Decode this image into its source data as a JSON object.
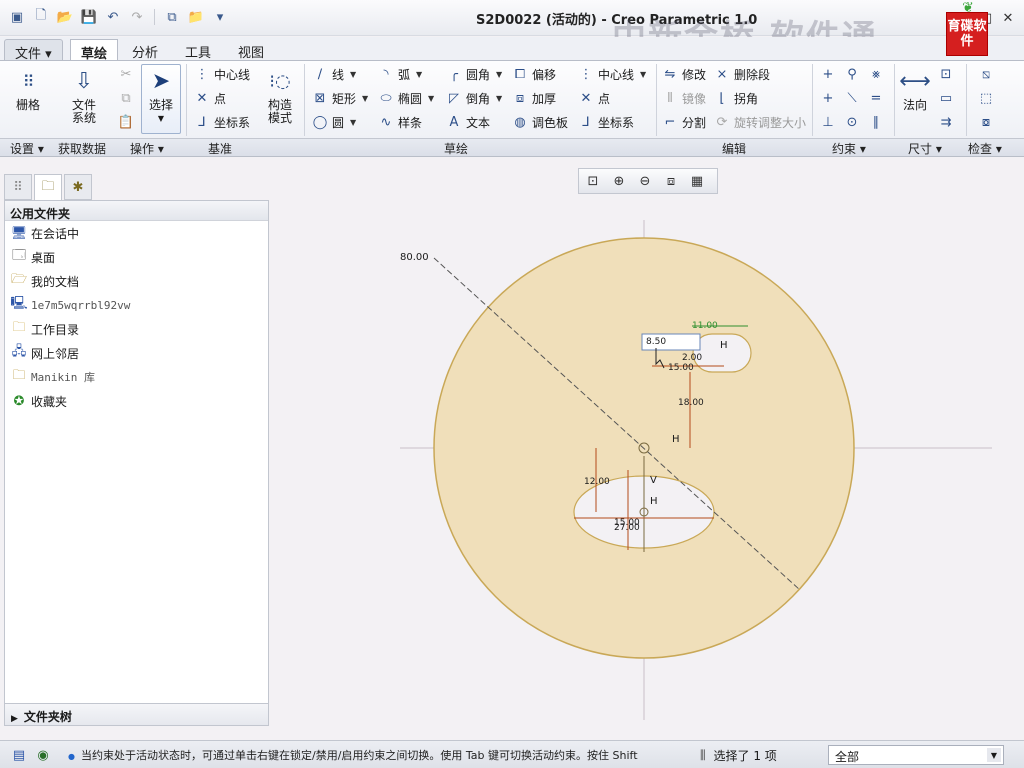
{
  "window": {
    "title": "S2D0022 (活动的) - Creo Parametric 1.0",
    "watermark": "中新金桥  软件通",
    "brand_logo": "育碟软件"
  },
  "menu_tabs": [
    "文件",
    "草绘",
    "分析",
    "工具",
    "视图"
  ],
  "ribbon": {
    "settings_big": "栅格",
    "file_system_big_line1": "文件",
    "file_system_big_line2": "系统",
    "select_big": "选择",
    "datum": {
      "centerline": "中心线",
      "point": "点",
      "coord": "坐标系"
    },
    "construct_line1": "构造",
    "construct_line2": "模式",
    "sketch": {
      "line": "线",
      "rect": "矩形",
      "circle": "圆",
      "arc": "弧",
      "ellipse": "椭圆",
      "spline": "样条",
      "fillet": "圆角",
      "chamfer": "倒角",
      "text": "文本",
      "offset": "偏移",
      "thicken": "加厚",
      "palette": "调色板",
      "centerline": "中心线",
      "point": "点",
      "coord": "坐标系"
    },
    "edit": {
      "modify": "修改",
      "delete_seg": "删除段",
      "mirror": "镜像",
      "corner": "拐角",
      "divide": "分割",
      "rotate_resize": "旋转调整大小"
    },
    "normal": "法向"
  },
  "groups": [
    "设置",
    "获取数据",
    "操作",
    "基准",
    "草绘",
    "编辑",
    "约束",
    "尺寸",
    "检查"
  ],
  "panel": {
    "header": "公用文件夹",
    "items": [
      {
        "label": "在会话中",
        "icon": "monitor-icon"
      },
      {
        "label": "桌面",
        "icon": "desktop-icon"
      },
      {
        "label": "我的文档",
        "icon": "documents-icon"
      },
      {
        "label": "1e7m5wqrrbl92vw",
        "icon": "computer-icon"
      },
      {
        "label": "工作目录",
        "icon": "folder-icon"
      },
      {
        "label": "网上邻居",
        "icon": "network-icon"
      },
      {
        "label": "Manikin 库",
        "icon": "library-icon"
      },
      {
        "label": "收藏夹",
        "icon": "favorites-icon"
      }
    ],
    "footer": "文件夹树"
  },
  "sketch_dims": {
    "d80": "80.00",
    "d11": "11.00",
    "d15_top": "15.00",
    "d18": "18.00",
    "d12": "12.00",
    "d15_low": "15.00",
    "d27": "27.00",
    "d2": "2.00",
    "edit_value": "8.50",
    "h": "H",
    "v": "V"
  },
  "status": {
    "message": "当约束处于活动状态时，可通过单击右键在锁定/禁用/启用约束之间切换。使用 Tab 键可切换活动约束。按住 Shift",
    "selected": "选择了 1 项",
    "filter": "全部"
  },
  "colors": {
    "sketch_fill": "#f0dfba",
    "sketch_edge": "#c9a857",
    "dimension": "#1a1a1a",
    "weak_dimension": "#2f8f2f"
  }
}
